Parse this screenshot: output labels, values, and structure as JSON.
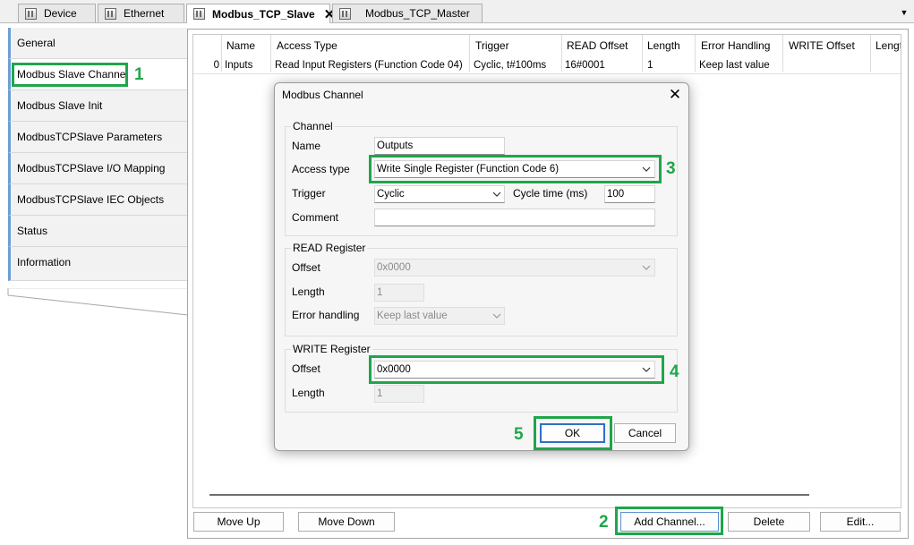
{
  "tabs": [
    {
      "label": "Device"
    },
    {
      "label": "Ethernet"
    },
    {
      "label": "Modbus_TCP_Slave"
    },
    {
      "label": "Modbus_TCP_Master"
    }
  ],
  "nav": [
    {
      "label": "General"
    },
    {
      "label": "Modbus Slave Channel"
    },
    {
      "label": "Modbus Slave Init"
    },
    {
      "label": "ModbusTCPSlave Parameters"
    },
    {
      "label": "ModbusTCPSlave I/O Mapping"
    },
    {
      "label": "ModbusTCPSlave IEC Objects"
    },
    {
      "label": "Status"
    },
    {
      "label": "Information"
    }
  ],
  "table": {
    "headers": [
      "Name",
      "Access Type",
      "Trigger",
      "READ Offset",
      "Length",
      "Error Handling",
      "WRITE Offset",
      "Lengt"
    ],
    "row": {
      "index": "0",
      "name": "Inputs",
      "access_type": "Read Input Registers (Function Code 04)",
      "trigger": "Cyclic, t#100ms",
      "read_offset": "16#0001",
      "length": "1",
      "error_handling": "Keep last value",
      "write_offset": "",
      "write_length": ""
    }
  },
  "bottom_buttons": {
    "move_up": "Move Up",
    "move_down": "Move Down",
    "add_channel": "Add Channel...",
    "delete": "Delete",
    "edit": "Edit..."
  },
  "dialog": {
    "title": "Modbus Channel",
    "channel": {
      "group_label": "Channel",
      "name_label": "Name",
      "name_value": "Outputs",
      "access_type_label": "Access type",
      "access_type_value": "Write Single Register (Function Code 6)",
      "trigger_label": "Trigger",
      "trigger_value": "Cyclic",
      "cycle_time_label": "Cycle time (ms)",
      "cycle_time_value": "100",
      "comment_label": "Comment",
      "comment_value": ""
    },
    "read_register": {
      "group_label": "READ Register",
      "offset_label": "Offset",
      "offset_value": "0x0000",
      "length_label": "Length",
      "length_value": "1",
      "error_handling_label": "Error handling",
      "error_handling_value": "Keep last value"
    },
    "write_register": {
      "group_label": "WRITE Register",
      "offset_label": "Offset",
      "offset_value": "0x0000",
      "length_label": "Length",
      "length_value": "1"
    },
    "ok_label": "OK",
    "cancel_label": "Cancel"
  },
  "callouts": [
    "1",
    "2",
    "3",
    "4",
    "5"
  ],
  "colors": {
    "highlight": "#1fa64a",
    "nav_accent": "#6a9fd6"
  },
  "icons": [
    "device-tab-icon",
    "close-icon",
    "chevron-down-icon"
  ]
}
